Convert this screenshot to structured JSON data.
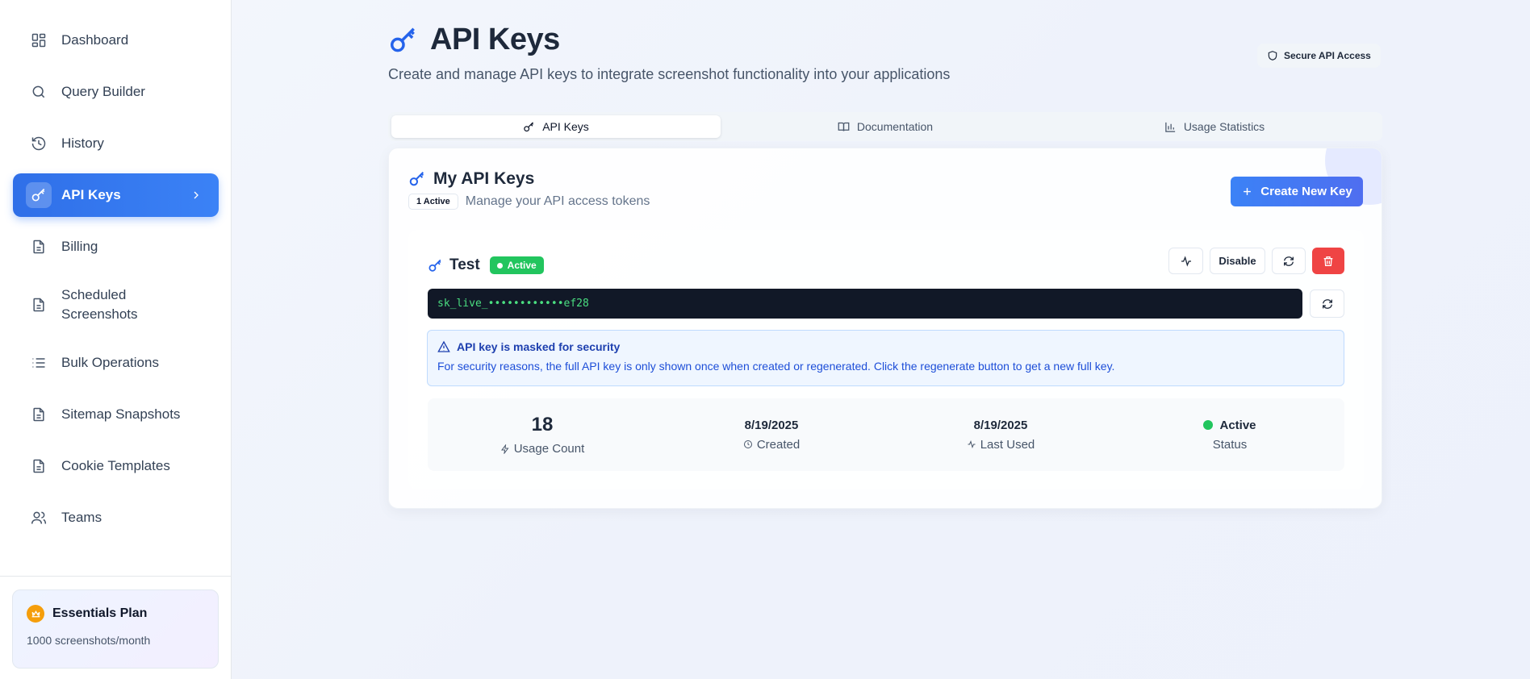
{
  "sidebar": {
    "items": [
      {
        "label": "Dashboard",
        "icon": "dashboard-icon"
      },
      {
        "label": "Query Builder",
        "icon": "search-icon"
      },
      {
        "label": "History",
        "icon": "history-icon"
      },
      {
        "label": "API Keys",
        "icon": "key-icon",
        "active": true
      },
      {
        "label": "Billing",
        "icon": "document-icon"
      },
      {
        "label": "Scheduled Screenshots",
        "icon": "document-icon"
      },
      {
        "label": "Bulk Operations",
        "icon": "list-icon"
      },
      {
        "label": "Sitemap Snapshots",
        "icon": "document-icon"
      },
      {
        "label": "Cookie Templates",
        "icon": "document-icon"
      },
      {
        "label": "Teams",
        "icon": "users-icon"
      }
    ],
    "plan": {
      "name": "Essentials Plan",
      "quota": "1000 screenshots/month",
      "icon": "crown-icon"
    }
  },
  "header": {
    "title": "API Keys",
    "subtitle": "Create and manage API keys to integrate screenshot functionality into your applications",
    "badge": "Secure API Access"
  },
  "tabs": [
    {
      "label": "API Keys",
      "icon": "key-icon",
      "active": true
    },
    {
      "label": "Documentation",
      "icon": "book-icon"
    },
    {
      "label": "Usage Statistics",
      "icon": "bar-chart-icon"
    }
  ],
  "card": {
    "title": "My API Keys",
    "count_badge": "1 Active",
    "subtitle": "Manage your API access tokens",
    "create_label": "Create New Key"
  },
  "key": {
    "name": "Test",
    "status_pill": "Active",
    "disable_label": "Disable",
    "masked_value": "sk_live_••••••••••••ef28",
    "alert_title": "API key is masked for security",
    "alert_body": "For security reasons, the full API key is only shown once when created or regenerated. Click the regenerate button to get a new full key.",
    "stats": [
      {
        "value": "18",
        "label": "Usage Count",
        "icon": "zap-icon"
      },
      {
        "value": "8/19/2025",
        "label": "Created",
        "icon": "clock-icon"
      },
      {
        "value": "8/19/2025",
        "label": "Last Used",
        "icon": "activity-icon"
      },
      {
        "value": "Active",
        "label": "Status",
        "icon": "status-dot"
      }
    ]
  },
  "colors": {
    "accent": "#3b82f6",
    "success": "#22c55e",
    "danger": "#ef4444",
    "key_bg": "#111827",
    "key_text": "#4ade80"
  }
}
